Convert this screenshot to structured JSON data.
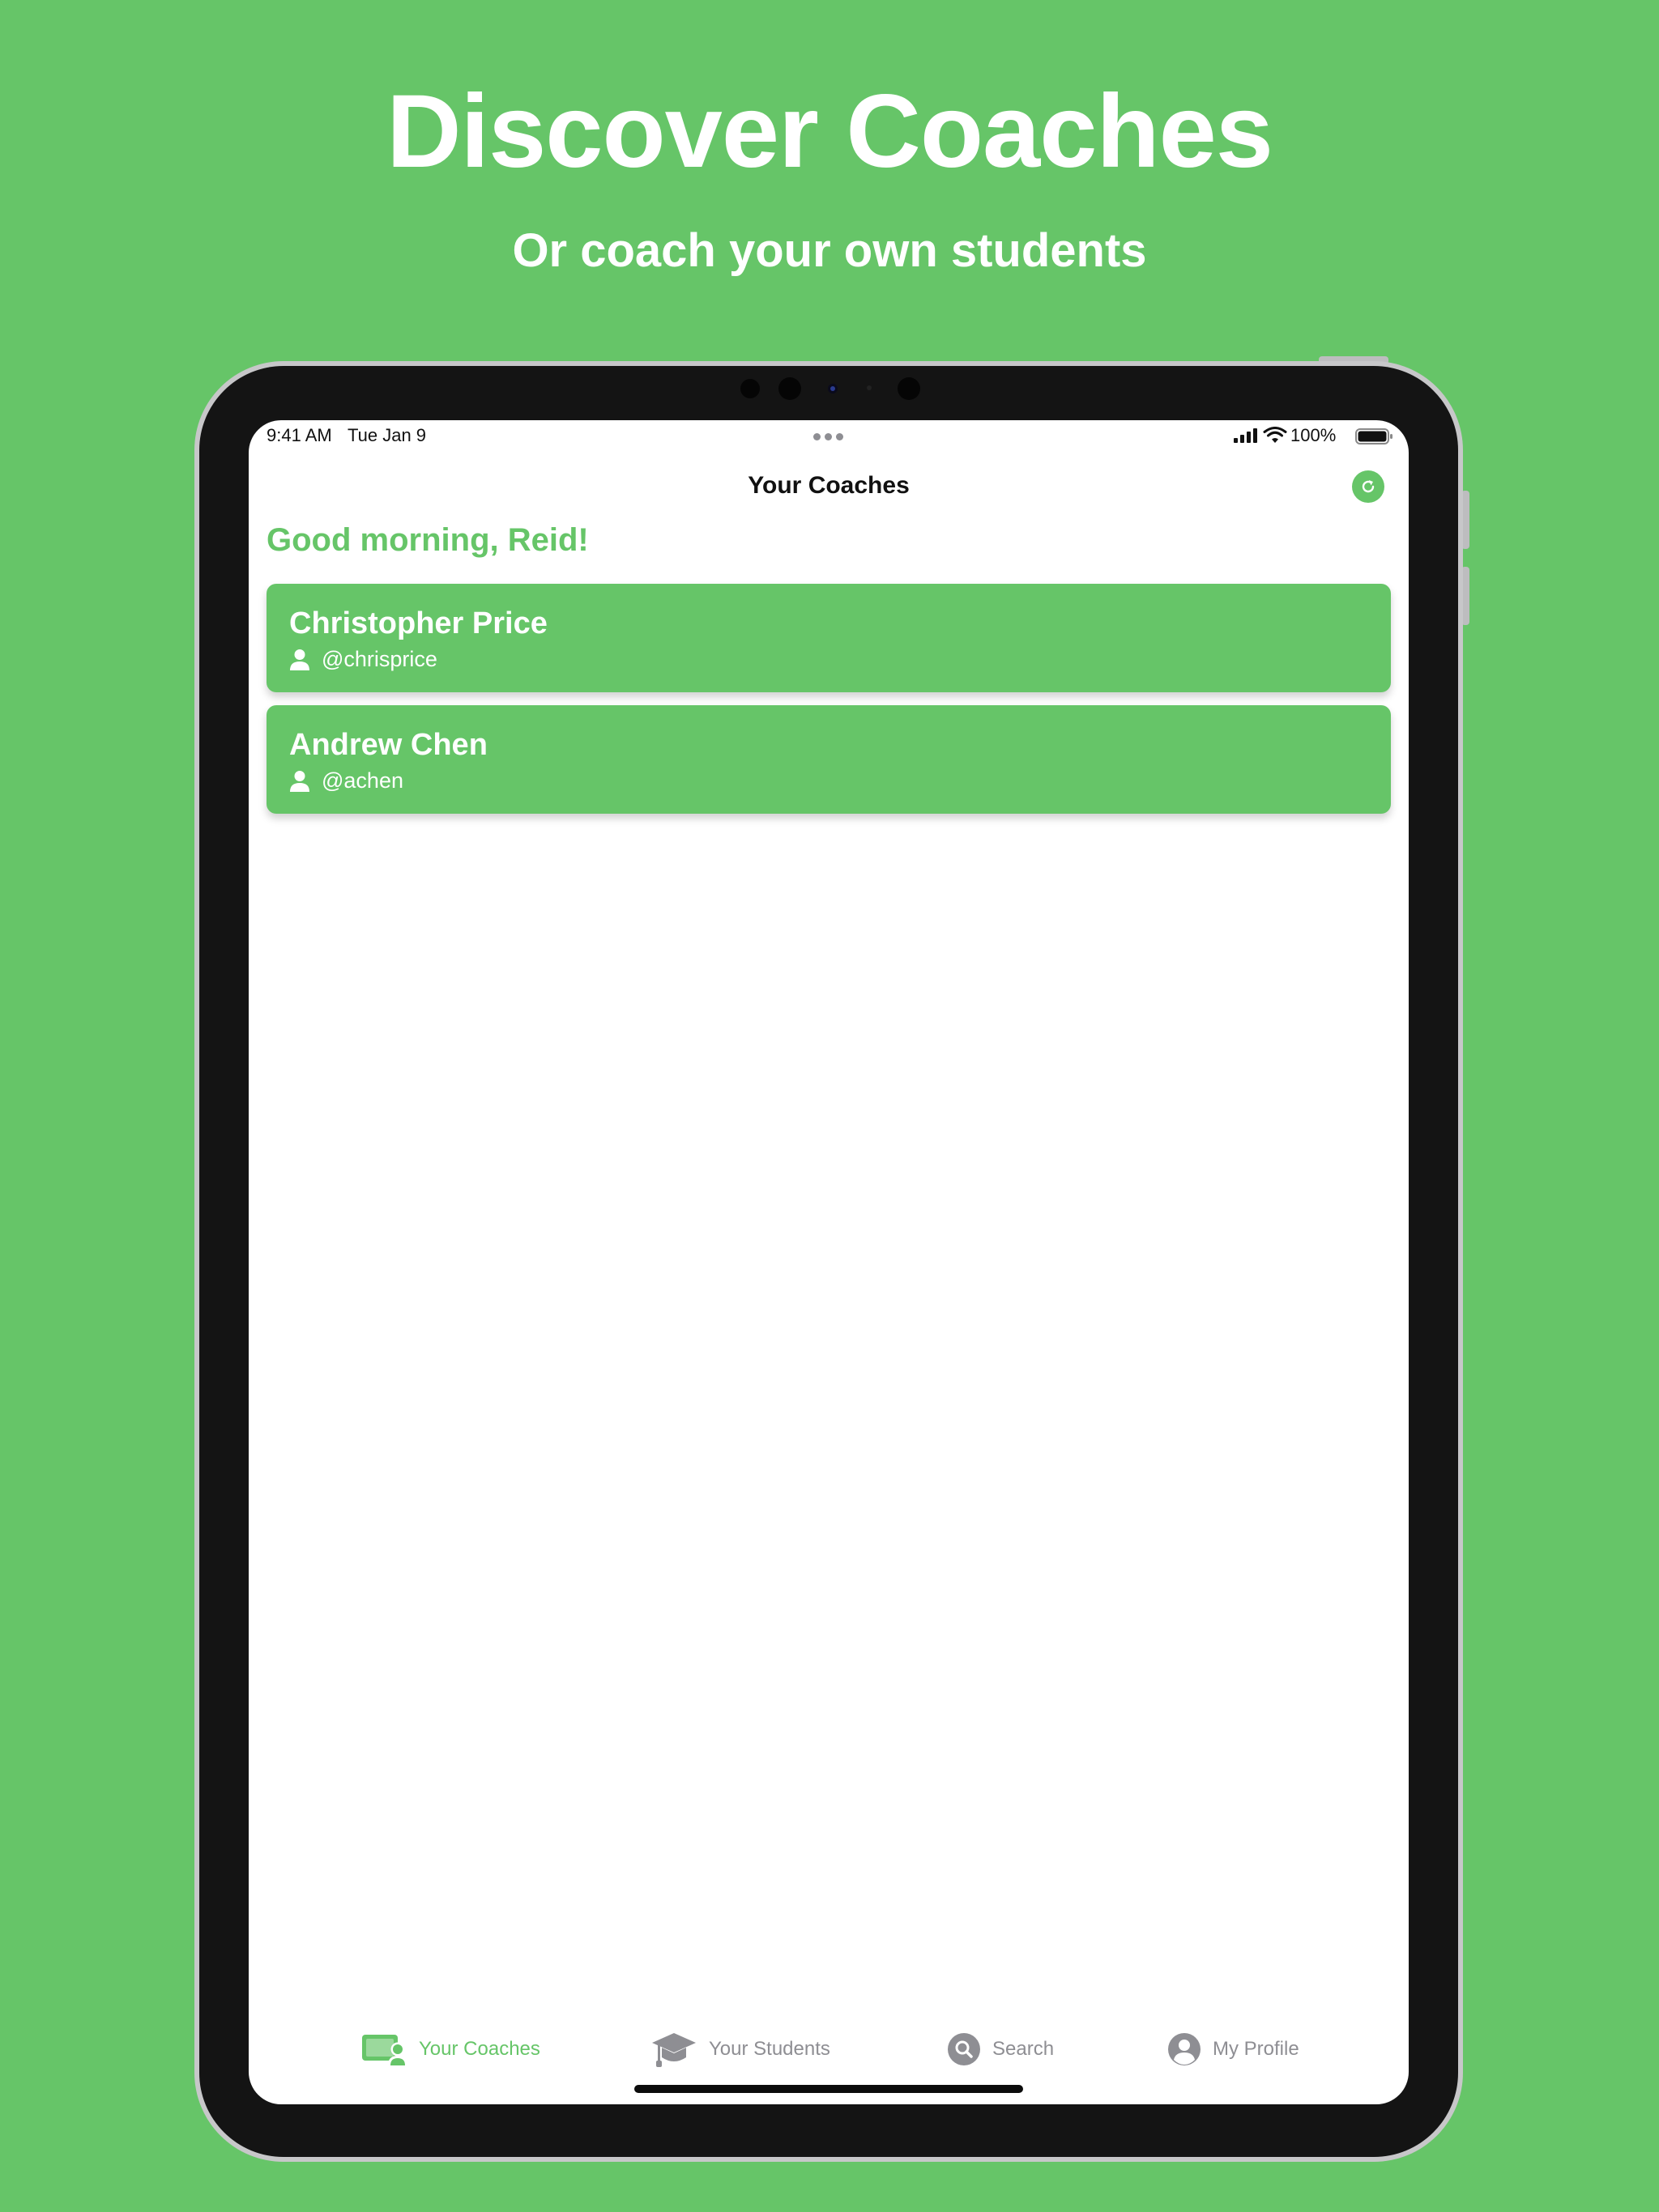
{
  "marketing": {
    "headline": "Discover Coaches",
    "subheadline": "Or coach your own students"
  },
  "status_bar": {
    "time": "9:41 AM",
    "date": "Tue Jan 9",
    "battery": "100%"
  },
  "nav": {
    "title": "Your Coaches",
    "refresh_icon": "refresh-icon"
  },
  "greeting": "Good morning, Reid!",
  "coaches": [
    {
      "name": "Christopher Price",
      "handle": "@chrisprice"
    },
    {
      "name": "Andrew Chen",
      "handle": "@achen"
    }
  ],
  "tabs": [
    {
      "label": "Your Coaches",
      "icon": "coach-board-icon",
      "active": true
    },
    {
      "label": "Your Students",
      "icon": "graduation-cap-icon",
      "active": false
    },
    {
      "label": "Search",
      "icon": "search-icon",
      "active": false
    },
    {
      "label": "My Profile",
      "icon": "profile-icon",
      "active": false
    }
  ],
  "colors": {
    "accent": "#66c568",
    "inactive": "#8e8e93",
    "background": "#66c568",
    "device": "#141414"
  }
}
